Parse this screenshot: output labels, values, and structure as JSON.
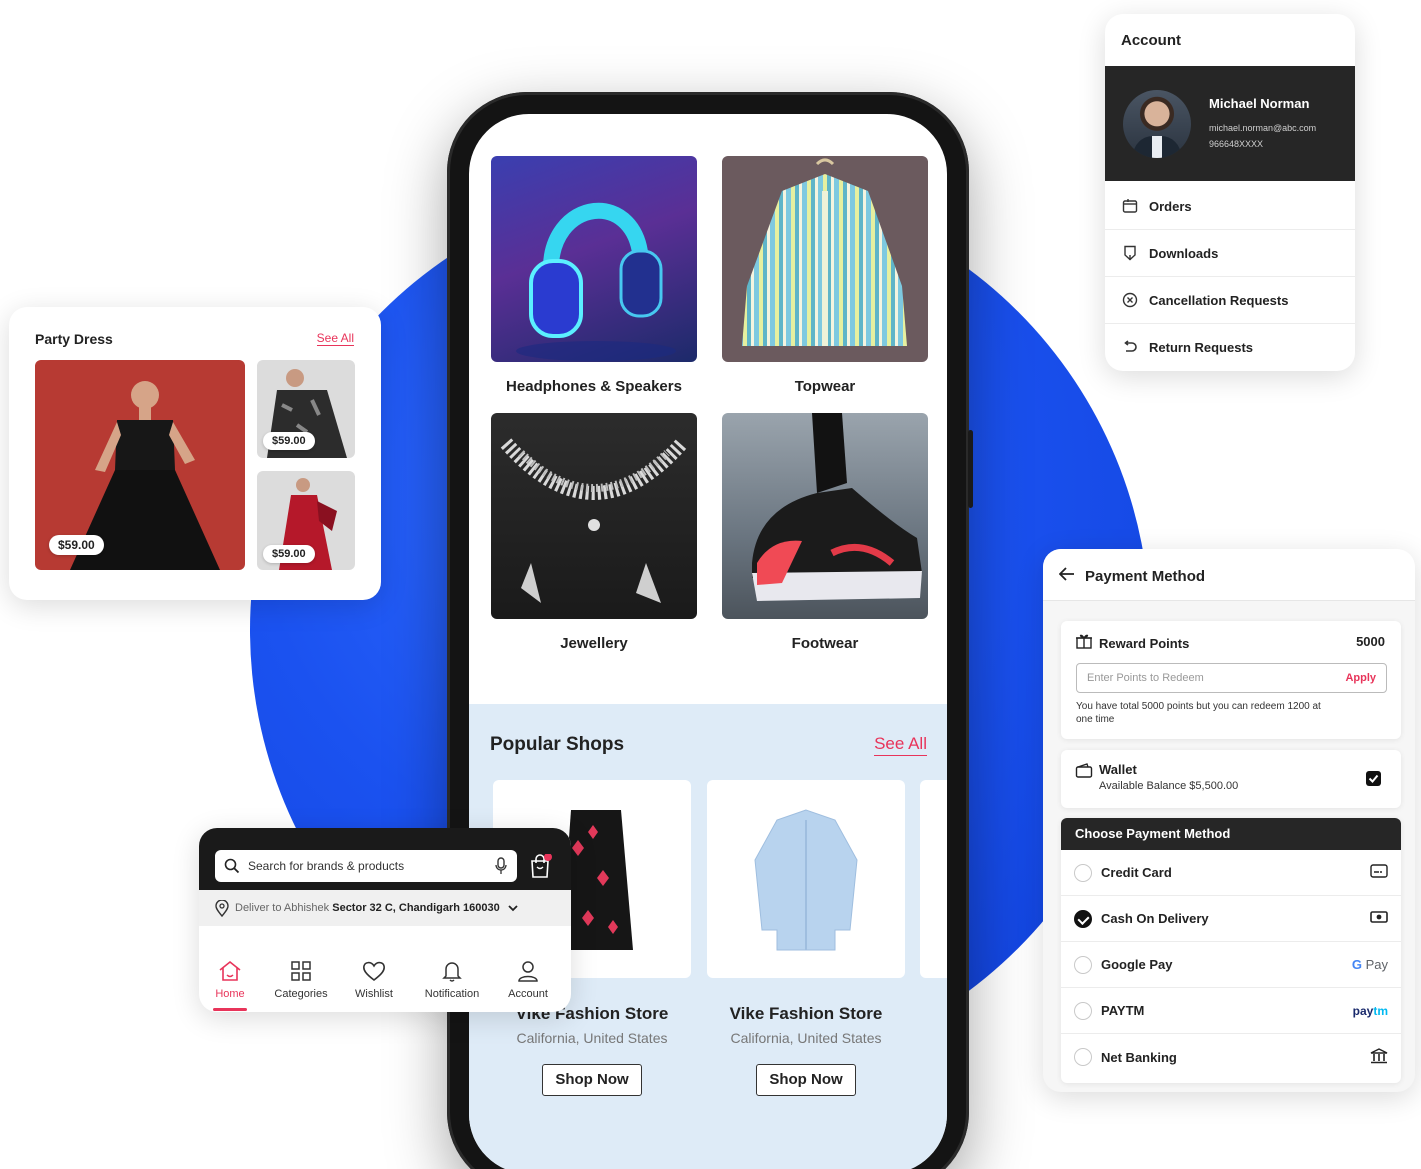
{
  "colors": {
    "accent": "#e8345a",
    "blue": "#1b52f0",
    "dark": "#262626"
  },
  "phone": {
    "categories": [
      {
        "label": "Headphones & Speakers",
        "image": "headphones"
      },
      {
        "label": "Topwear",
        "image": "striped-shirt"
      },
      {
        "label": "Jewellery",
        "image": "necklace"
      },
      {
        "label": "Footwear",
        "image": "sneaker"
      }
    ],
    "popular": {
      "title": "Popular Shops",
      "see_all": "See All",
      "shops": [
        {
          "name": "Vike Fashion Store",
          "location": "California, United States",
          "button": "Shop Now"
        },
        {
          "name": "Vike Fashion Store",
          "location": "California, United States",
          "button": "Shop Now"
        }
      ]
    }
  },
  "party": {
    "title": "Party Dress",
    "see_all": "See All",
    "prices": [
      "$59.00",
      "$59.00",
      "$59.00"
    ]
  },
  "account": {
    "title": "Account",
    "user": {
      "name": "Michael Norman",
      "email": "michael.norman@abc.com",
      "phone": "966648XXXX"
    },
    "items": [
      {
        "label": "Orders",
        "icon": "package-icon"
      },
      {
        "label": "Downloads",
        "icon": "download-icon"
      },
      {
        "label": "Cancellation Requests",
        "icon": "cancel-circle-icon"
      },
      {
        "label": "Return Requests",
        "icon": "return-arrow-icon"
      }
    ]
  },
  "payment": {
    "title": "Payment Method",
    "reward": {
      "label": "Reward Points",
      "points": "5000",
      "placeholder": "Enter Points to Redeem",
      "apply": "Apply",
      "note": "You have total 5000 points but you can redeem 1200 at one time"
    },
    "wallet": {
      "label": "Wallet",
      "balance": "Available Balance $5,500.00",
      "checked": true
    },
    "choose_label": "Choose Payment Method",
    "methods": [
      {
        "label": "Credit Card",
        "selected": false,
        "icon": "credit-card-icon"
      },
      {
        "label": "Cash On Delivery",
        "selected": true,
        "icon": "cash-icon"
      },
      {
        "label": "Google Pay",
        "selected": false,
        "icon": "gpay-logo"
      },
      {
        "label": "PAYTM",
        "selected": false,
        "icon": "paytm-logo"
      },
      {
        "label": "Net Banking",
        "selected": false,
        "icon": "bank-icon"
      }
    ]
  },
  "search": {
    "placeholder": "Search for brands & products",
    "deliver_prefix": "Deliver to Abhishek",
    "deliver_address": "Sector 32 C, Chandigarh 160030"
  },
  "nav": {
    "items": [
      {
        "label": "Home",
        "active": true
      },
      {
        "label": "Categories",
        "active": false
      },
      {
        "label": "Wishlist",
        "active": false
      },
      {
        "label": "Notification",
        "active": false
      },
      {
        "label": "Account",
        "active": false
      }
    ]
  }
}
